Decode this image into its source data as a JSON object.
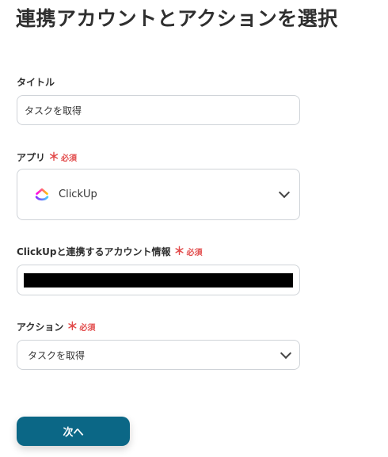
{
  "page": {
    "title": "連携アカウントとアクションを選択"
  },
  "colors": {
    "required": "#e24b4b",
    "primary_button": "#0b6786",
    "border": "#cfd3d8"
  },
  "fields": {
    "title": {
      "label": "タイトル",
      "value": "タスクを取得"
    },
    "app": {
      "label": "アプリ",
      "required_mark": "＊",
      "required_text": "必須",
      "value": "ClickUp",
      "icon": "clickup-logo-icon"
    },
    "account": {
      "label": "ClickUpと連携するアカウント情報",
      "required_mark": "＊",
      "required_text": "必須",
      "value_state": "redacted"
    },
    "action": {
      "label": "アクション",
      "required_mark": "＊",
      "required_text": "必須",
      "value": "タスクを取得"
    }
  },
  "buttons": {
    "next": "次へ"
  }
}
